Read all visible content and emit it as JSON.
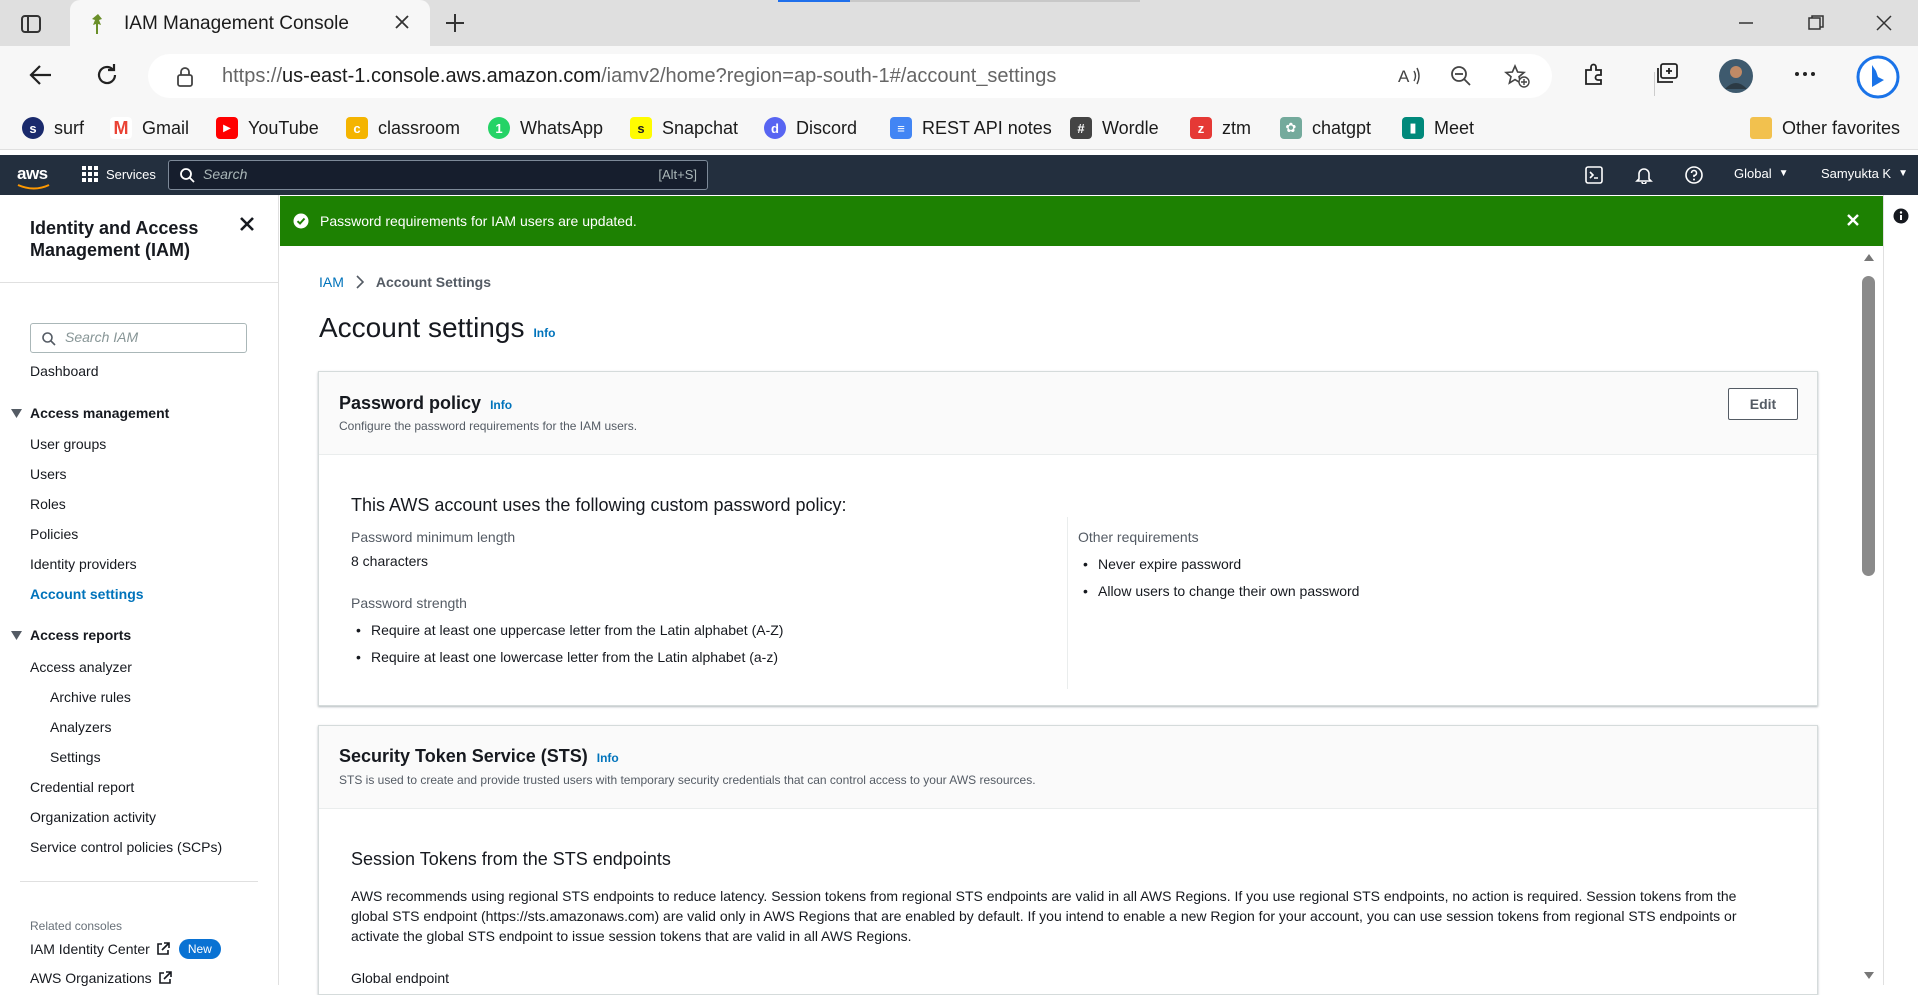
{
  "browser": {
    "tab_title": "IAM Management Console",
    "url_prefix": "https://",
    "url_domain": "us-east-1.console.aws.amazon.com",
    "url_path": "/iamv2/home?region=ap-south-1#/account_settings",
    "bookmarks": [
      {
        "label": "surf",
        "color": "#1a2a6c",
        "glyph": "s"
      },
      {
        "label": "Gmail",
        "color": "#ea4335",
        "glyph": "M"
      },
      {
        "label": "YouTube",
        "color": "#ff0000",
        "glyph": "▶"
      },
      {
        "label": "classroom",
        "color": "#f4b400",
        "glyph": "c"
      },
      {
        "label": "WhatsApp",
        "color": "#25d366",
        "glyph": "1"
      },
      {
        "label": "Snapchat",
        "color": "#fffc00",
        "glyph": "s"
      },
      {
        "label": "Discord",
        "color": "#5865f2",
        "glyph": "d"
      },
      {
        "label": "REST API notes",
        "color": "#4285f4",
        "glyph": "≡"
      },
      {
        "label": "Wordle",
        "color": "#444444",
        "glyph": "#"
      },
      {
        "label": "ztm",
        "color": "#e53935",
        "glyph": "z"
      },
      {
        "label": "chatgpt",
        "color": "#74aa9c",
        "glyph": "✿"
      },
      {
        "label": "Meet",
        "color": "#00897b",
        "glyph": "▮"
      }
    ],
    "other_favorites": "Other favorites"
  },
  "aws_nav": {
    "logo": "aws",
    "services": "Services",
    "search_placeholder": "Search",
    "search_shortcut": "[Alt+S]",
    "region": "Global",
    "user": "Samyukta K"
  },
  "sidebar": {
    "title": "Identity and Access Management (IAM)",
    "search_placeholder": "Search IAM",
    "dashboard": "Dashboard",
    "access_management": {
      "heading": "Access management",
      "items": [
        "User groups",
        "Users",
        "Roles",
        "Policies",
        "Identity providers",
        "Account settings"
      ]
    },
    "access_reports": {
      "heading": "Access reports",
      "access_analyzer": "Access analyzer",
      "analyzer_sub": [
        "Archive rules",
        "Analyzers",
        "Settings"
      ],
      "items": [
        "Credential report",
        "Organization activity",
        "Service control policies (SCPs)"
      ]
    },
    "related_consoles": "Related consoles",
    "identity_center": "IAM Identity Center",
    "new_badge": "New",
    "organizations": "AWS Organizations"
  },
  "flash": {
    "message": "Password requirements for IAM users are updated."
  },
  "breadcrumb": {
    "root": "IAM",
    "current": "Account Settings"
  },
  "page": {
    "title": "Account settings",
    "info": "Info"
  },
  "password_policy": {
    "title": "Password policy",
    "info": "Info",
    "description": "Configure the password requirements for the IAM users.",
    "edit": "Edit",
    "heading": "This AWS account uses the following custom password policy:",
    "min_length_label": "Password minimum length",
    "min_length_value": "8 characters",
    "strength_label": "Password strength",
    "strength_items": [
      "Require at least one uppercase letter from the Latin alphabet (A-Z)",
      "Require at least one lowercase letter from the Latin alphabet (a-z)"
    ],
    "other_label": "Other requirements",
    "other_items": [
      "Never expire password",
      "Allow users to change their own password"
    ]
  },
  "sts": {
    "title": "Security Token Service (STS)",
    "info": "Info",
    "description": "STS is used to create and provide trusted users with temporary security credentials that can control access to your AWS resources.",
    "session_heading": "Session Tokens from the STS endpoints",
    "paragraph": "AWS recommends using regional STS endpoints to reduce latency. Session tokens from regional STS endpoints are valid in all AWS Regions. If you use regional STS endpoints, no action is required. Session tokens from the global STS endpoint (https://sts.amazonaws.com) are valid only in AWS Regions that are enabled by default. If you intend to enable a new Region for your account, you can use session tokens from regional STS endpoints or activate the global STS endpoint to issue session tokens that are valid in all AWS Regions.",
    "global_endpoint": "Global endpoint"
  }
}
